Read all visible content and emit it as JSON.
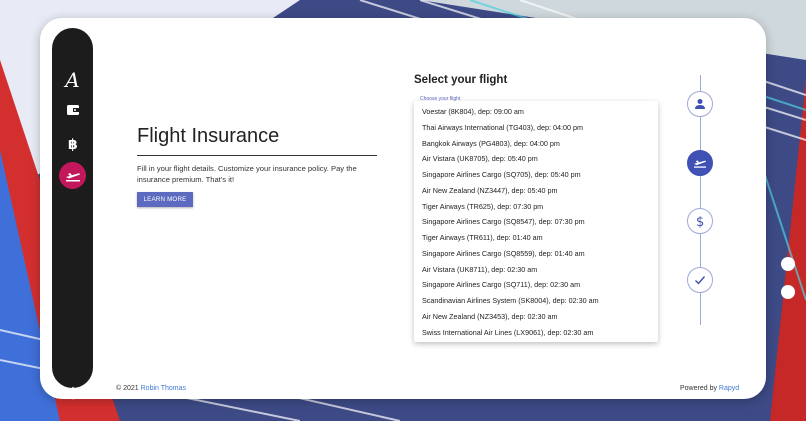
{
  "sidebar": {
    "logo_text": "A",
    "items": [
      {
        "icon": "wallet-icon"
      },
      {
        "icon": "bitcoin-icon"
      },
      {
        "icon": "flight-takeoff-icon",
        "active": true
      }
    ],
    "power_icon": "power-icon"
  },
  "hero": {
    "title": "Flight Insurance",
    "description": "Fill in your flight details. Customize your insurance policy. Pay the insurance premium. That's it!",
    "learn_more": "LEARN MORE"
  },
  "flight_select": {
    "title": "Select your flight",
    "hint": "Choose your flight",
    "options": [
      "Voestar (8K804), dep: 09:00 am",
      "Thai Airways International (TG403), dep: 04:00 pm",
      "Bangkok Airways (PG4803), dep: 04:00 pm",
      "Air Vistara (UK8705), dep: 05:40 pm",
      "Singapore Airlines Cargo (SQ705), dep: 05:40 pm",
      "Air New Zealand (NZ3447), dep: 05:40 pm",
      "Tiger Airways (TR625), dep: 07:30 pm",
      "Singapore Airlines Cargo (SQ8547), dep: 07:30 pm",
      "Tiger Airways (TR611), dep: 01:40 am",
      "Singapore Airlines Cargo (SQ8559), dep: 01:40 am",
      "Air Vistara (UK8711), dep: 02:30 am",
      "Singapore Airlines Cargo (SQ711), dep: 02:30 am",
      "Scandinavian Airlines System (SK8004), dep: 02:30 am",
      "Air New Zealand (NZ3453), dep: 02:30 am",
      "Swiss International Air Lines (LX9061), dep: 02:30 am"
    ]
  },
  "stepper": {
    "steps": [
      {
        "icon": "person-icon"
      },
      {
        "icon": "flight-takeoff-icon",
        "active": true
      },
      {
        "icon": "dollar-icon"
      },
      {
        "icon": "check-icon"
      }
    ]
  },
  "footer": {
    "copyright": "© 2021 ",
    "author": "Robin Thomas",
    "powered_by": "Powered by ",
    "brand": "Rapyd"
  },
  "colors": {
    "accent": "#3f51b5",
    "button": "#5c6bc0",
    "sidebar_active": "#c2185b",
    "sidebar_bg": "#1c1c1c"
  }
}
